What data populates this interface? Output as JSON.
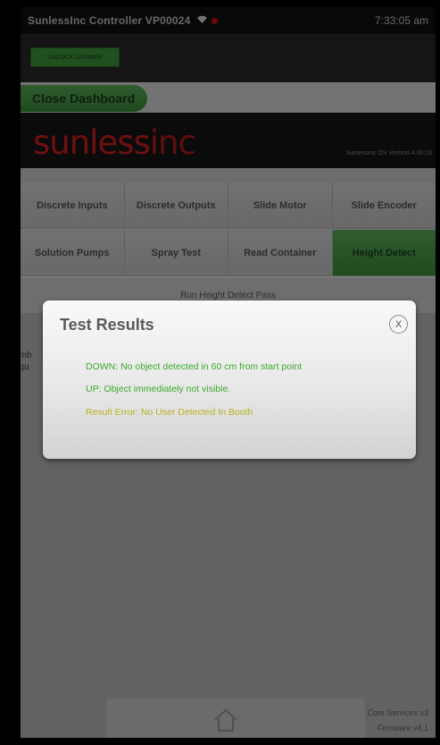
{
  "status_bar": {
    "title": "SunlessInc Controller  VP00024",
    "time": "7:33:05 am"
  },
  "top_bar": {
    "unlock_label": "UNLOCK DRAWER"
  },
  "dash_bar": {
    "close_label": "Close Dashboard"
  },
  "brand": {
    "logo_bold": "sunless",
    "logo_light": "inc",
    "os_version": "Sunlessinc OS Version 4.00.03"
  },
  "tabs_row1": [
    {
      "label": "Discrete Inputs"
    },
    {
      "label": "Discrete Outputs"
    },
    {
      "label": "Slide Motor"
    },
    {
      "label": "Slide Encoder"
    }
  ],
  "tabs_row2": [
    {
      "label": "Solution Pumps"
    },
    {
      "label": "Spray Test"
    },
    {
      "label": "Read Container"
    },
    {
      "label": "Height Detect",
      "active": true
    }
  ],
  "run_bar": {
    "label": "Run Height Detect Pass"
  },
  "side_text": {
    "line1": "umb",
    "line2": "equ"
  },
  "bottom_info": {
    "line1": "Core Services v3",
    "line2": "Firmware v4.1"
  },
  "dialog": {
    "title": "Test Results",
    "close_glyph": "X",
    "messages": [
      "DOWN: No object detected in 60 cm from start point",
      "UP: Object immediately not visible.",
      "Result Error: No User Detected In Booth"
    ]
  },
  "colors": {
    "accent_green": "#4aa64a",
    "logo_red": "#d42020",
    "success_text": "#3aaa2a",
    "warning_text": "#b8b020"
  }
}
